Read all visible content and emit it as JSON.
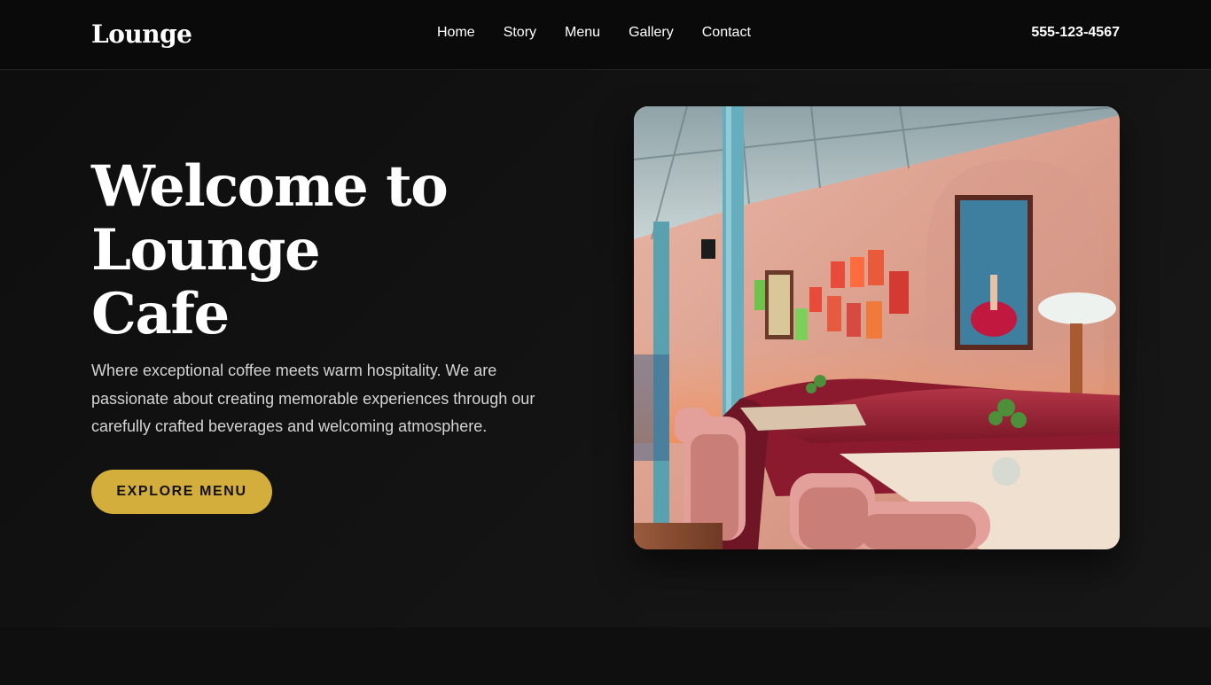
{
  "header": {
    "logo": "Lounge",
    "nav": [
      "Home",
      "Story",
      "Menu",
      "Gallery",
      "Contact"
    ],
    "phone": "555-123-4567"
  },
  "hero": {
    "title_lines": [
      "Welcome to",
      "Lounge",
      "Cafe"
    ],
    "description": "Where exceptional coffee meets warm hospitality. We are passionate about creating memorable experiences through our carefully crafted beverages and welcoming atmosphere.",
    "cta_label": "EXPLORE MENU"
  },
  "colors": {
    "background": "#101010",
    "header_background": "#0a0a0a",
    "accent": "#d4ae3c",
    "text": "#ffffff",
    "muted_text": "#d4d4d4"
  }
}
